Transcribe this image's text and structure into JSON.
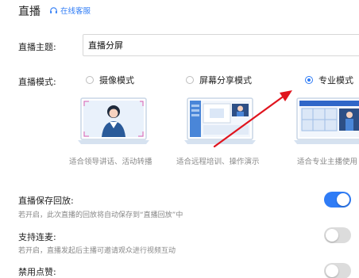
{
  "header": {
    "title": "直播",
    "customer_service": "在线客服"
  },
  "topic": {
    "label": "直播主题:",
    "value": "直播分屏"
  },
  "mode": {
    "label": "直播模式:",
    "options": [
      {
        "label": "摄像模式",
        "caption": "适合领导讲话、活动转播",
        "selected": false
      },
      {
        "label": "屏幕分享模式",
        "caption": "适合远程培训、操作演示",
        "selected": false
      },
      {
        "label": "专业模式",
        "caption": "适合专业主播使用",
        "selected": true
      }
    ]
  },
  "settings": [
    {
      "title": "直播保存回放:",
      "desc": "若开启，此次直播的回放将自动保存到“直播回放”中",
      "enabled": true
    },
    {
      "title": "支持连麦:",
      "desc": "若开启，直播发起后主播可邀请观众进行视频互动",
      "enabled": false
    },
    {
      "title": "禁用点赞:",
      "desc": "",
      "enabled": false
    }
  ],
  "colors": {
    "accent": "#2f7cf6",
    "arrow": "#e0141e",
    "toggle_off": "#dcdcdc"
  }
}
